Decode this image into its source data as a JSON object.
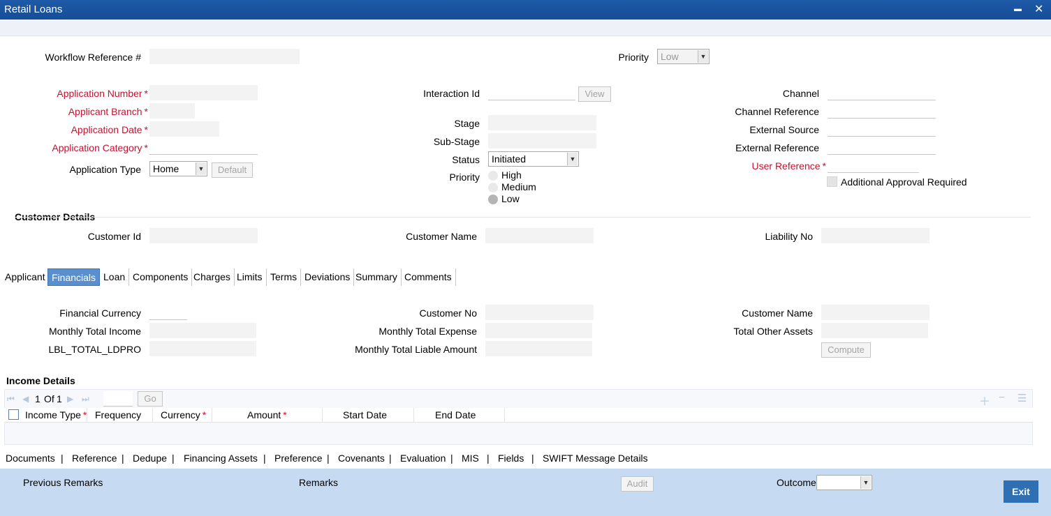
{
  "window": {
    "title": "Retail Loans",
    "minimize": "▬",
    "close": "✕"
  },
  "header": {
    "workflow_ref_label": "Workflow Reference #",
    "priority_label": "Priority",
    "priority_value": "Low"
  },
  "app": {
    "app_number_label": "Application Number",
    "applicant_branch_label": "Applicant Branch",
    "app_date_label": "Application Date",
    "app_category_label": "Application Category",
    "app_type_label": "Application Type",
    "app_type_value": "Home",
    "default_button": "Default",
    "required_mark": "*"
  },
  "middle": {
    "interaction_id_label": "Interaction Id",
    "view_button": "View",
    "stage_label": "Stage",
    "substage_label": "Sub-Stage",
    "status_label": "Status",
    "status_value": "Initiated",
    "priority_label": "Priority",
    "priority_options": [
      "High",
      "Medium",
      "Low"
    ],
    "priority_selected": "Low"
  },
  "right": {
    "channel_label": "Channel",
    "channel_ref_label": "Channel Reference",
    "external_source_label": "External Source",
    "external_ref_label": "External Reference",
    "user_ref_label": "User Reference",
    "additional_approval_label": "Additional Approval Required"
  },
  "customer": {
    "section_title": "Customer Details",
    "customer_id_label": "Customer Id",
    "customer_name_label": "Customer Name",
    "liability_no_label": "Liability No"
  },
  "tabs": [
    "Applicant",
    "Financials",
    "Loan",
    "Components",
    "Charges",
    "Limits",
    "Terms",
    "Deviations",
    "Summary",
    "Comments"
  ],
  "active_tab": "Financials",
  "financials": {
    "fin_currency_label": "Financial Currency",
    "monthly_income_label": "Monthly Total Income",
    "total_ldpro_label": "LBL_TOTAL_LDPRO",
    "customer_no_label": "Customer No",
    "monthly_expense_label": "Monthly Total Expense",
    "monthly_liable_label": "Monthly Total Liable Amount",
    "customer_name_label": "Customer Name",
    "total_other_assets_label": "Total Other Assets",
    "compute_button": "Compute"
  },
  "income": {
    "section_title": "Income Details",
    "page_current": "1",
    "page_of": "Of",
    "page_total": "1",
    "go_button": "Go",
    "columns": [
      "Income Type",
      "Frequency",
      "Currency",
      "Amount",
      "Start Date",
      "End Date"
    ]
  },
  "footer_links": [
    "Documents",
    "Reference",
    "Dedupe",
    "Financing Assets",
    "Preference",
    "Covenants",
    "Evaluation",
    "MIS",
    "Fields",
    "SWIFT Message Details"
  ],
  "footer_sep": "|",
  "bottom": {
    "previous_remarks": "Previous Remarks",
    "remarks": "Remarks",
    "audit_button": "Audit",
    "outcome_label": "Outcome",
    "exit_button": "Exit"
  }
}
